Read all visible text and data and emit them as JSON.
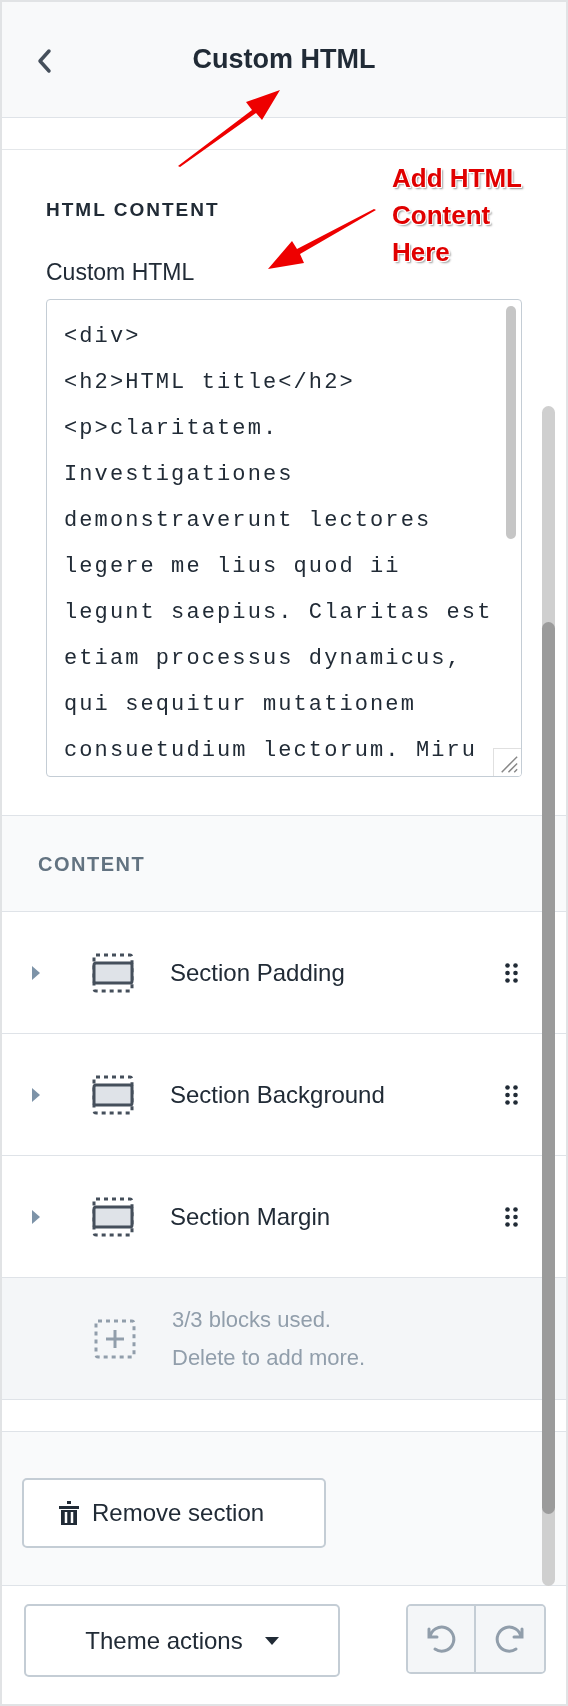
{
  "header": {
    "title": "Custom HTML"
  },
  "html_section": {
    "heading": "HTML CONTENT",
    "field_label": "Custom HTML",
    "field_lines": [
      "<div>",
      "<h2>HTML title</h2>",
      "<p>claritatem.",
      "Investigationes",
      "demonstraverunt lectores",
      "legere me lius quod ii",
      "legunt saepius. Claritas est",
      "etiam processus dynamicus,",
      "qui sequitur mutationem",
      "consuetudium lectorum. Miru"
    ]
  },
  "content": {
    "heading": "CONTENT",
    "blocks": [
      {
        "label": "Section Padding",
        "expanded": false
      },
      {
        "label": "Section Background",
        "expanded": false
      },
      {
        "label": "Section Margin",
        "expanded": false
      }
    ],
    "limit_lines": [
      "3/3 blocks used.",
      "Delete to add more."
    ]
  },
  "remove_button": "Remove section",
  "footer": {
    "theme_actions": "Theme actions"
  },
  "callout": "Add HTML Content Here"
}
